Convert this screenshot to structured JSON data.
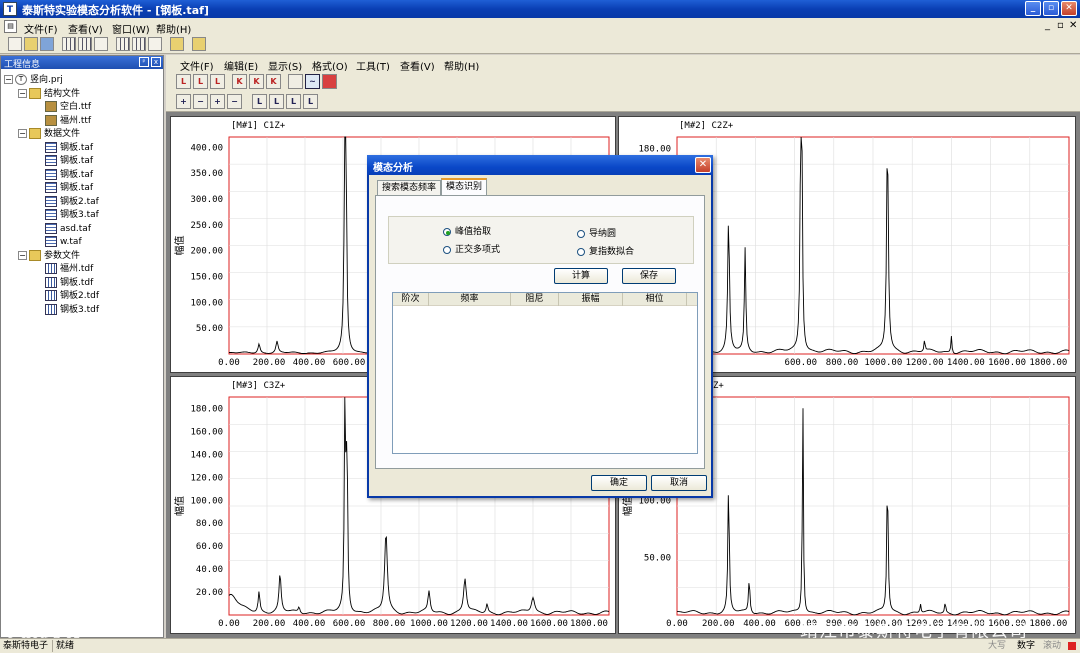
{
  "window": {
    "icon": "T",
    "title": "泰斯特实验模态分析软件 - [钢板.taf]",
    "controls": [
      "_",
      "▫",
      "✕"
    ]
  },
  "menubar": {
    "items": [
      "文件(F)",
      "查看(V)",
      "窗口(W)",
      "帮助(H)"
    ],
    "mdi_controls": [
      "_",
      "▫",
      "✕"
    ]
  },
  "project_panel": {
    "title": "工程信息",
    "pin": "ᵖ",
    "close": "x",
    "root": "竖向.prj",
    "groups": [
      {
        "name": "结构文件",
        "files": [
          "空白.ttf",
          "福州.ttf"
        ]
      },
      {
        "name": "数据文件",
        "files": [
          "钢板.taf",
          "钢板.taf",
          "钢板.taf",
          "钢板.taf",
          "钢板2.taf",
          "钢板3.taf",
          "asd.taf",
          "w.taf"
        ]
      },
      {
        "name": "参数文件",
        "files": [
          "福州.tdf",
          "钢板.tdf",
          "钢板2.tdf",
          "钢板3.tdf"
        ]
      }
    ]
  },
  "inner_menubar": {
    "items": [
      "文件(F)",
      "编辑(E)",
      "显示(S)",
      "格式(O)",
      "工具(T)",
      "查看(V)",
      "帮助(H)"
    ]
  },
  "plots": [
    {
      "title": "[M#1] C1Z+",
      "ylabel": "幅值",
      "yticks": [
        "400.00",
        "350.00",
        "300.00",
        "250.00",
        "200.00",
        "150.00",
        "100.00",
        "50.00"
      ],
      "xticks": [
        "0.00",
        "200.00",
        "400.00",
        "600.00"
      ],
      "ymax": 420,
      "xmax": 1900
    },
    {
      "title": "[M#2] C2Z+",
      "ylabel": "幅值",
      "yticks": [
        "180.00"
      ],
      "xticks": [
        "600.00",
        "800.00",
        "1000.00",
        "1200.00",
        "1400.00",
        "1600.00",
        "1800.00"
      ],
      "ymax": 190,
      "xmax": 1900
    },
    {
      "title": "[M#3] C3Z+",
      "ylabel": "幅值",
      "yticks": [
        "180.00",
        "160.00",
        "140.00",
        "120.00",
        "100.00",
        "80.00",
        "60.00",
        "40.00",
        "20.00"
      ],
      "xticks": [
        "0.00",
        "200.00",
        "400.00",
        "600.00",
        "800.00",
        "1000.00",
        "1200.00",
        "1400.00",
        "1600.00",
        "1800.00"
      ],
      "ymax": 190,
      "xmax": 1900
    },
    {
      "title": "Z+",
      "ylabel": "幅值",
      "yticks": [
        "150.00",
        "100.00",
        "50.00"
      ],
      "xticks": [
        "0.00",
        "200.00",
        "400.00",
        "600.00",
        "800.00",
        "1000.00",
        "1200.00",
        "1400.00",
        "1600.00",
        "1800.00"
      ],
      "ymax": 190,
      "xmax": 1900
    }
  ],
  "dialog": {
    "title": "模态分析",
    "close": "✕",
    "tabs": [
      "搜索模态频率",
      "模态识别"
    ],
    "active_tab": 1,
    "radios": [
      {
        "label": "峰值拾取",
        "checked": true
      },
      {
        "label": "正交多项式",
        "checked": false
      },
      {
        "label": "导纳圆",
        "checked": false
      },
      {
        "label": "复指数拟合",
        "checked": false
      }
    ],
    "compute_button": "计算",
    "save_button": "保存",
    "columns": [
      "阶次",
      "频率",
      "阻尼",
      "振幅",
      "相位"
    ],
    "ok_button": "确定",
    "cancel_button": "取消"
  },
  "statusbar": {
    "left": "泰斯特电子",
    "mid": "就绪",
    "caps": "大写",
    "num": "数字",
    "scroll": "滚动"
  },
  "watermarks": {
    "left": "大数跨境",
    "right": "靖江市泰斯特电子有限公司"
  }
}
